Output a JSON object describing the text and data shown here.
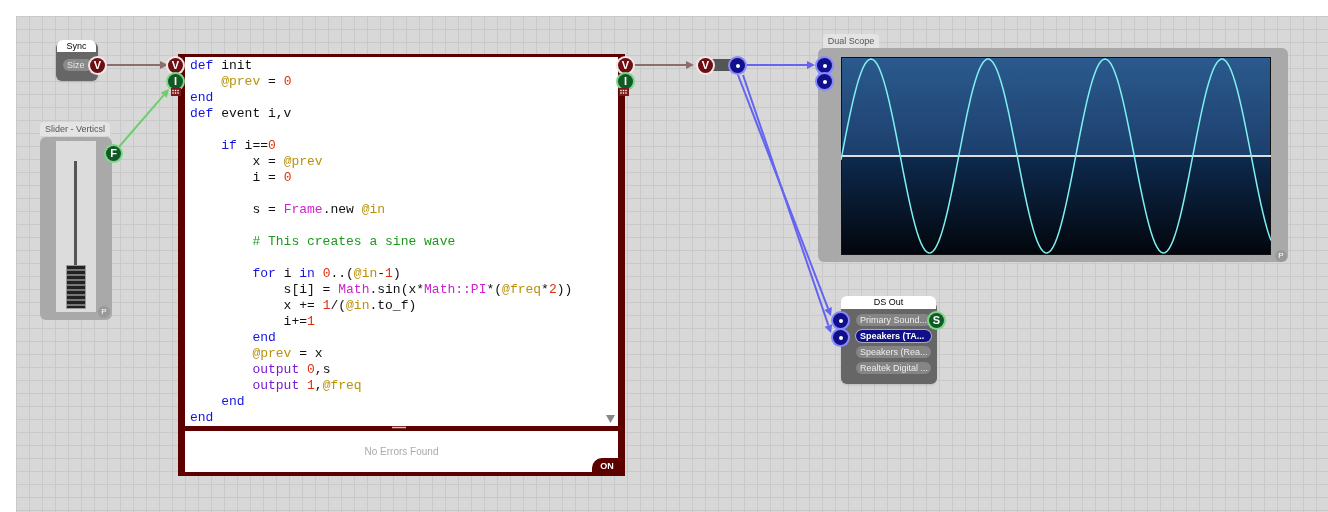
{
  "sync": {
    "title": "Sync",
    "output_label": "Size",
    "port": {
      "kind": "value",
      "label": "V"
    }
  },
  "slider": {
    "title": "Slider - Verticsl",
    "level": 0,
    "port": {
      "kind": "float",
      "label": "F"
    },
    "badge": "P"
  },
  "code_module": {
    "inputs": [
      {
        "kind": "value",
        "label": "V"
      },
      {
        "kind": "int",
        "label": "I"
      }
    ],
    "outputs": [
      {
        "kind": "value",
        "label": "V"
      },
      {
        "kind": "int",
        "label": "I"
      }
    ],
    "lines": [
      {
        "kind": "code",
        "segments": [
          {
            "kind": "keyword",
            "text": "def"
          },
          {
            "kind": "plain",
            "text": " init"
          }
        ]
      },
      {
        "kind": "code",
        "segments": [
          {
            "kind": "ivar",
            "text": "    @prev"
          },
          {
            "kind": "plain",
            "text": " = "
          },
          {
            "kind": "number",
            "text": "0"
          }
        ]
      },
      {
        "kind": "code",
        "segments": [
          {
            "kind": "keyword",
            "text": "end"
          }
        ]
      },
      {
        "kind": "code",
        "segments": [
          {
            "kind": "keyword",
            "text": "def"
          },
          {
            "kind": "plain",
            "text": " event i,v"
          }
        ]
      },
      {
        "kind": "blank"
      },
      {
        "kind": "code",
        "segments": [
          {
            "kind": "keyword",
            "text": "    if"
          },
          {
            "kind": "plain",
            "text": " i=="
          },
          {
            "kind": "number",
            "text": "0"
          }
        ]
      },
      {
        "kind": "code",
        "segments": [
          {
            "kind": "plain",
            "text": "        x = "
          },
          {
            "kind": "ivar",
            "text": "@prev"
          }
        ]
      },
      {
        "kind": "code",
        "segments": [
          {
            "kind": "plain",
            "text": "        i = "
          },
          {
            "kind": "number",
            "text": "0"
          }
        ]
      },
      {
        "kind": "blank"
      },
      {
        "kind": "code",
        "segments": [
          {
            "kind": "plain",
            "text": "        s = "
          },
          {
            "kind": "class",
            "text": "Frame"
          },
          {
            "kind": "plain",
            "text": ".new "
          },
          {
            "kind": "ivar",
            "text": "@in"
          }
        ]
      },
      {
        "kind": "blank"
      },
      {
        "kind": "code",
        "segments": [
          {
            "kind": "comment",
            "text": "        # This creates a sine wave"
          }
        ]
      },
      {
        "kind": "blank"
      },
      {
        "kind": "code",
        "segments": [
          {
            "kind": "keyword",
            "text": "        for"
          },
          {
            "kind": "plain",
            "text": " i "
          },
          {
            "kind": "keyword",
            "text": "in"
          },
          {
            "kind": "number",
            "text": " 0"
          },
          {
            "kind": "plain",
            "text": "..("
          },
          {
            "kind": "ivar",
            "text": "@in"
          },
          {
            "kind": "plain",
            "text": "-"
          },
          {
            "kind": "number",
            "text": "1"
          },
          {
            "kind": "plain",
            "text": ")"
          }
        ]
      },
      {
        "kind": "code",
        "segments": [
          {
            "kind": "plain",
            "text": "            s[i] = "
          },
          {
            "kind": "class",
            "text": "Math"
          },
          {
            "kind": "plain",
            "text": ".sin(x*"
          },
          {
            "kind": "class",
            "text": "Math::PI"
          },
          {
            "kind": "plain",
            "text": "*("
          },
          {
            "kind": "ivar",
            "text": "@freq"
          },
          {
            "kind": "plain",
            "text": "*"
          },
          {
            "kind": "number",
            "text": "2"
          },
          {
            "kind": "plain",
            "text": "))"
          }
        ]
      },
      {
        "kind": "code",
        "segments": [
          {
            "kind": "plain",
            "text": "            x += "
          },
          {
            "kind": "number",
            "text": "1"
          },
          {
            "kind": "plain",
            "text": "/("
          },
          {
            "kind": "ivar",
            "text": "@in"
          },
          {
            "kind": "plain",
            "text": ".to_f)"
          }
        ]
      },
      {
        "kind": "code",
        "segments": [
          {
            "kind": "plain",
            "text": "            i+="
          },
          {
            "kind": "number",
            "text": "1"
          }
        ]
      },
      {
        "kind": "code",
        "segments": [
          {
            "kind": "keyword",
            "text": "        end"
          }
        ]
      },
      {
        "kind": "code",
        "segments": [
          {
            "kind": "ivar",
            "text": "        @prev"
          },
          {
            "kind": "plain",
            "text": " = x"
          }
        ]
      },
      {
        "kind": "code",
        "segments": [
          {
            "kind": "method",
            "text": "        output"
          },
          {
            "kind": "number",
            "text": " 0"
          },
          {
            "kind": "plain",
            "text": ",s"
          }
        ]
      },
      {
        "kind": "code",
        "segments": [
          {
            "kind": "method",
            "text": "        output"
          },
          {
            "kind": "number",
            "text": " 1"
          },
          {
            "kind": "plain",
            "text": ","
          },
          {
            "kind": "ivar",
            "text": "@freq"
          }
        ]
      },
      {
        "kind": "code",
        "segments": [
          {
            "kind": "keyword",
            "text": "    end"
          }
        ]
      },
      {
        "kind": "code",
        "segments": [
          {
            "kind": "keyword",
            "text": "end"
          }
        ]
      }
    ],
    "status": "No Errors Found",
    "toggle": {
      "label": "ON",
      "on": true
    }
  },
  "converter": {
    "input": {
      "kind": "value",
      "label": "V"
    },
    "output": {
      "kind": "frame"
    }
  },
  "dual_scope": {
    "title": "Dual Scope",
    "inputs": [
      {
        "kind": "frame"
      },
      {
        "kind": "frame"
      }
    ],
    "badge": "P"
  },
  "ds_out": {
    "title": "DS Out",
    "inputs": [
      {
        "kind": "frame"
      },
      {
        "kind": "frame"
      }
    ],
    "output": {
      "kind": "string",
      "label": "S"
    },
    "devices": [
      {
        "label": "Primary Sound...",
        "selected": false
      },
      {
        "label": "Speakers (TA...",
        "selected": true
      },
      {
        "label": "Speakers (Rea...",
        "selected": false
      },
      {
        "label": "Realtek Digital ...",
        "selected": false
      }
    ]
  }
}
